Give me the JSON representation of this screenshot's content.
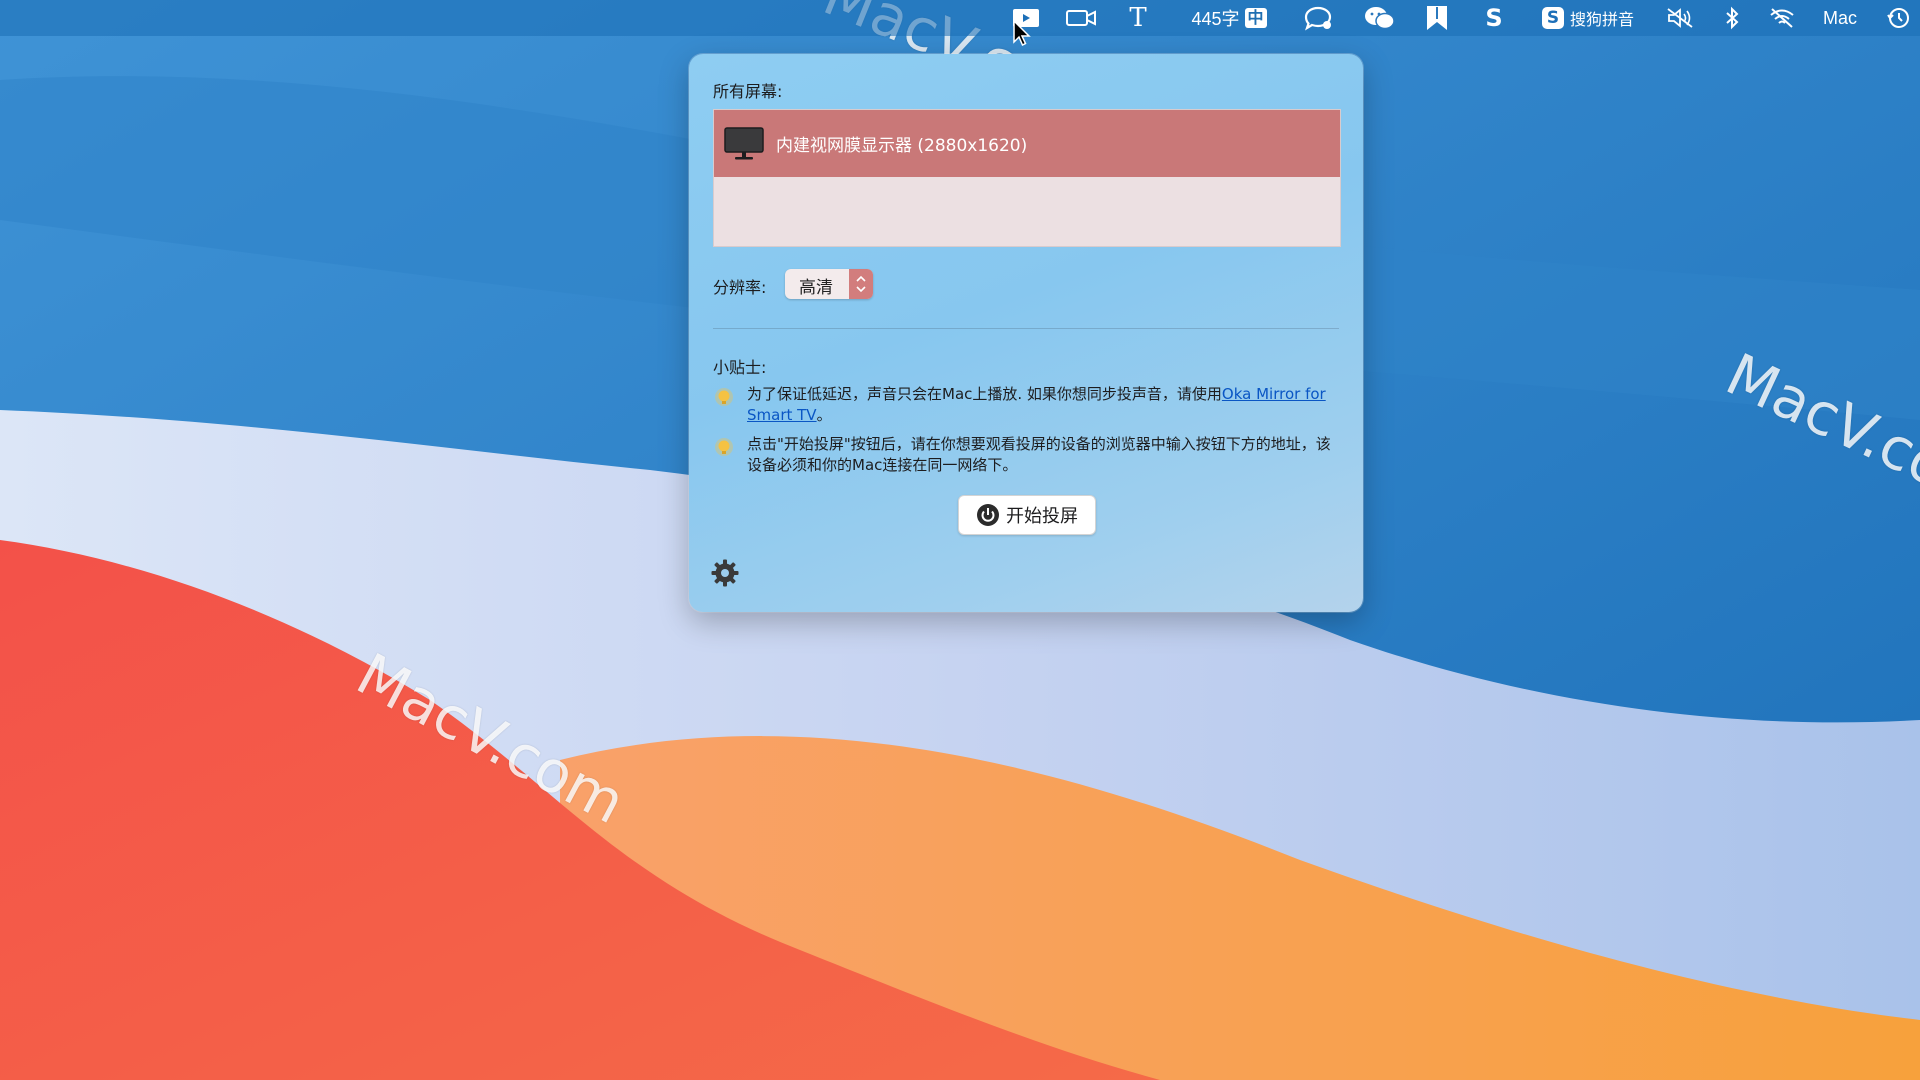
{
  "menubar": {
    "word_count": "445字",
    "ime_indicator": "中",
    "sogou_label": "搜狗拼音",
    "user_label": "Mac",
    "icons": [
      "screen-mirror-icon",
      "video-camera-icon",
      "text-icon",
      "chat-bubble-icon",
      "wechat-icon",
      "bookmark-icon",
      "s-app-icon",
      "sogou-icon",
      "mute-icon",
      "bluetooth-icon",
      "wifi-off-icon",
      "time-machine-icon"
    ]
  },
  "watermark": {
    "text": "MacV.com"
  },
  "panel": {
    "screens_label": "所有屏幕:",
    "screens": [
      {
        "name": "内建视网膜显示器 (2880x1620)",
        "selected": true
      }
    ],
    "resolution_label": "分辨率:",
    "resolution_value": "高清",
    "tips_label": "小贴士:",
    "tip1_text": "为了保证低延迟，声音只会在Mac上播放. 如果你想同步投声音，请使用",
    "tip1_link": "Oka Mirror for Smart TV",
    "tip1_end": "。",
    "tip2_text": "点击\"开始投屏\"按钮后，请在你想要观看投屏的设备的浏览器中输入按钮下方的地址，该设备必须和你的Mac连接在同一网络下。",
    "start_button": "开始投屏"
  },
  "colors": {
    "selected_row": "#c97878",
    "link": "#0a56c4",
    "panel_bg": "#8ecdf2"
  }
}
